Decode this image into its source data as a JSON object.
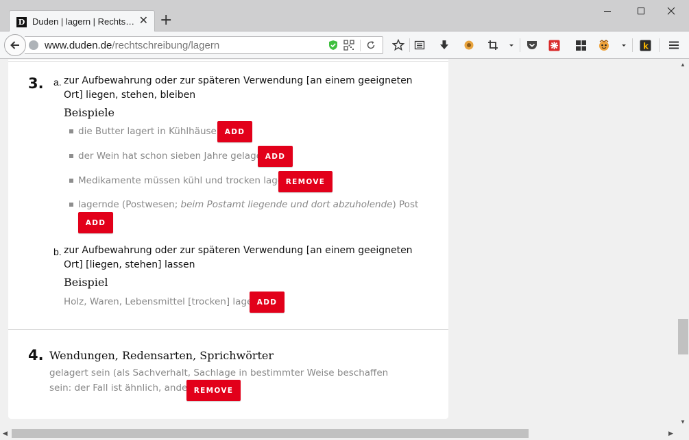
{
  "browser": {
    "tab_title": "Duden | lagern | Rechts…",
    "tab_favicon_letter": "D",
    "new_tab_symbol": "+",
    "url_domain": "www.duden.de",
    "url_path": "/rechtschreibung/lagern"
  },
  "content": {
    "sense3": {
      "number": "3.",
      "a": {
        "letter": "a.",
        "definition": "zur Aufbewahrung oder zur späteren Verwendung [an einem geeigneten Ort] liegen, stehen, bleiben",
        "examples_heading": "Beispiele",
        "examples": [
          {
            "text": "die Butter lagert in Kühlhäusern",
            "button": "ADD"
          },
          {
            "text": "der Wein hat schon sieben Jahre gelagert",
            "button": "ADD"
          },
          {
            "text": "Medikamente müssen kühl und trocken lagern",
            "button": "REMOVE"
          },
          {
            "text_before": "lagernde (Postwesen; ",
            "text_italic": "beim Postamt liegende und dort abzuholende",
            "text_after": ") Post",
            "button": "ADD"
          }
        ]
      },
      "b": {
        "letter": "b.",
        "definition": "zur Aufbewahrung oder zur späteren Verwendung [an einem geeigneten Ort] [liegen, stehen] lassen",
        "examples_heading": "Beispiel",
        "example": {
          "text": "Holz, Waren, Lebensmittel [trocken] lagern",
          "button": "ADD"
        }
      }
    },
    "sense4": {
      "number": "4.",
      "heading": "Wendungen, Redensarten, Sprichwörter",
      "idiom": {
        "text": "gelagert sein (als Sachverhalt, Sachlage in bestimmter Weise beschaffen sein: der Fall ist ähnlich, anders gelagert)",
        "button": "REMOVE"
      }
    }
  },
  "colors": {
    "button_red": "#e2001a",
    "example_gray": "#888888"
  }
}
